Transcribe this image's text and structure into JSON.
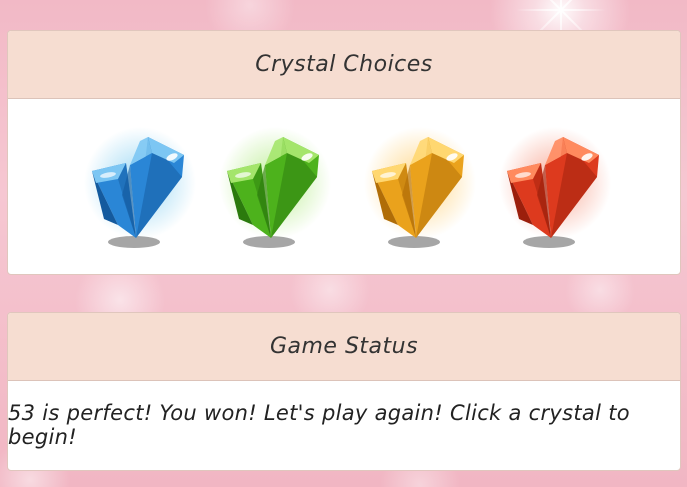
{
  "crystals_panel": {
    "title": "Crystal Choices",
    "crystals": [
      {
        "name": "blue",
        "icon": "blue-crystal-icon",
        "base": "#2a86d6",
        "dark": "#145a9e",
        "light": "#7cc6f3",
        "glow": "#8fd3f2"
      },
      {
        "name": "green",
        "icon": "green-crystal-icon",
        "base": "#4db21c",
        "dark": "#2b7a0d",
        "light": "#a4e56b",
        "glow": "#b6ec8a"
      },
      {
        "name": "yellow",
        "icon": "yellow-crystal-icon",
        "base": "#eaa21c",
        "dark": "#b06d07",
        "light": "#ffd770",
        "glow": "#ffd27a"
      },
      {
        "name": "red",
        "icon": "red-crystal-icon",
        "base": "#dd3a1e",
        "dark": "#9b1f0c",
        "light": "#ff8a5e",
        "glow": "#f7a08b"
      }
    ]
  },
  "status_panel": {
    "title": "Game Status",
    "message": "53 is perfect! You won! Let's play again! Click a crystal to begin!"
  }
}
